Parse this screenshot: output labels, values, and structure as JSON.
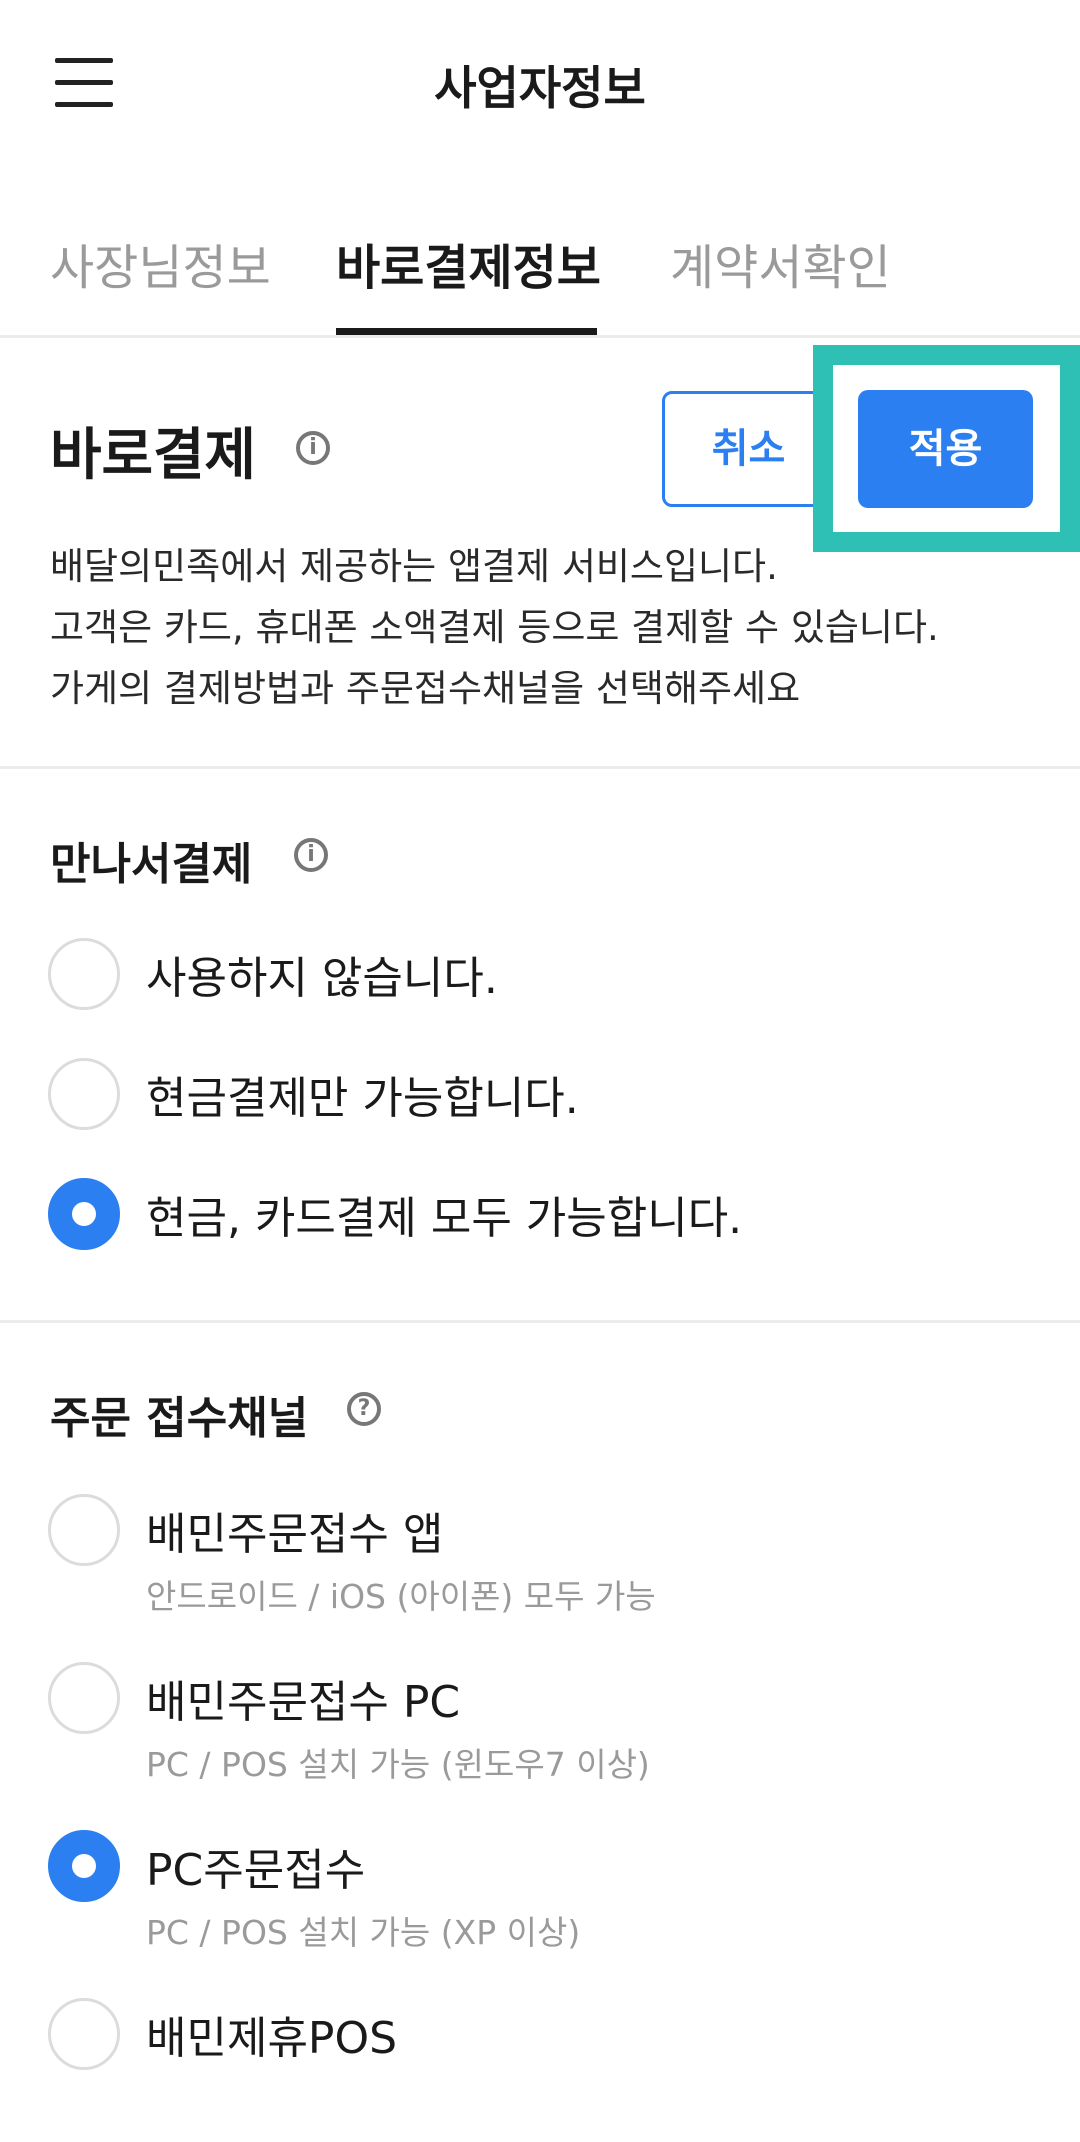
{
  "header": {
    "title": "사업자정보",
    "menu_icon": "hamburger-menu-icon"
  },
  "tabs": [
    {
      "label": "사장님정보",
      "active": false
    },
    {
      "label": "바로결제정보",
      "active": true
    },
    {
      "label": "계약서확인",
      "active": false
    }
  ],
  "baro_payment": {
    "title": "바로결제",
    "info_icon": "info-icon",
    "cancel_label": "취소",
    "apply_label": "적용",
    "description": [
      "배달의민족에서 제공하는 앱결제 서비스입니다.",
      "고객은 카드, 휴대폰 소액결제 등으로 결제할 수 있습니다.",
      "가게의 결제방법과 주문접수채널을 선택해주세요"
    ]
  },
  "meet_payment": {
    "title": "만나서결제",
    "info_icon": "info-icon",
    "options": [
      {
        "label": "사용하지 않습니다.",
        "checked": false
      },
      {
        "label": "현금결제만 가능합니다.",
        "checked": false
      },
      {
        "label": "현금, 카드결제 모두 가능합니다.",
        "checked": true
      }
    ]
  },
  "order_channel": {
    "title": "주문 접수채널",
    "help_icon": "question-icon",
    "options": [
      {
        "label": "배민주문접수 앱",
        "sub": "안드로이드 / iOS (아이폰) 모두 가능",
        "checked": false
      },
      {
        "label": "배민주문접수 PC",
        "sub": "PC / POS 설치 가능 (윈도우7 이상)",
        "checked": false
      },
      {
        "label": "PC주문접수",
        "sub": "PC / POS 설치 가능 (XP 이상)",
        "checked": true
      },
      {
        "label": "배민제휴POS",
        "sub": "",
        "checked": false
      }
    ]
  },
  "colors": {
    "accent": "#2b7ff0",
    "highlight": "#2fc0b5",
    "divider": "#ececec"
  }
}
